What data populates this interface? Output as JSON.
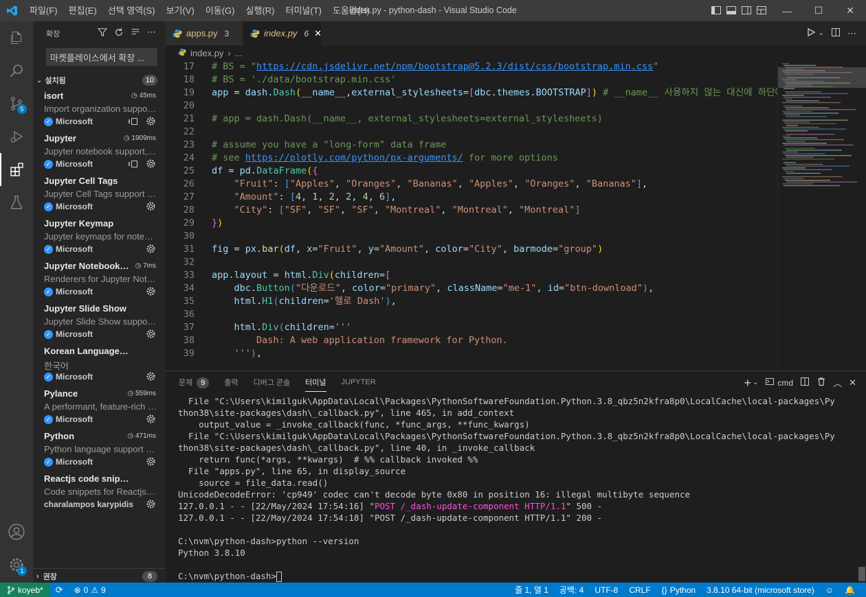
{
  "window": {
    "title": "index.py - python-dash - Visual Studio Code",
    "menu": [
      "파일(F)",
      "편집(E)",
      "선택 영역(S)",
      "보기(V)",
      "이동(G)",
      "실행(R)",
      "터미널(T)",
      "도움말(H)"
    ],
    "controls": {
      "minimize": "—",
      "maximize": "☐",
      "close": "✕"
    }
  },
  "activity_bar": {
    "scm_badge": "5",
    "settings_badge": "1"
  },
  "sidebar": {
    "title": "확장",
    "search_placeholder": "마켓플레이스에서 확장 ...",
    "installed_label": "설치됨",
    "installed_count": "10",
    "recommended_label": "권장",
    "recommended_count": "8",
    "extensions": [
      {
        "name": "isort",
        "time": "45ms",
        "desc": "Import organization support for Python",
        "publisher": "Microsoft",
        "verified": true,
        "sync": true
      },
      {
        "name": "Jupyter",
        "time": "1909ms",
        "desc": "Jupyter notebook support, interactive",
        "publisher": "Microsoft",
        "verified": true,
        "sync": true
      },
      {
        "name": "Jupyter Cell Tags",
        "time": "",
        "desc": "Jupyter Cell Tags support for VS Code",
        "publisher": "Microsoft",
        "verified": true,
        "sync": false
      },
      {
        "name": "Jupyter Keymap",
        "time": "",
        "desc": "Jupyter keymaps for notebooks",
        "publisher": "Microsoft",
        "verified": true,
        "sync": false
      },
      {
        "name": "Jupyter Notebook Renderers",
        "time": "7ms",
        "desc": "Renderers for Jupyter Notebooks",
        "publisher": "Microsoft",
        "verified": true,
        "sync": false
      },
      {
        "name": "Jupyter Slide Show",
        "time": "",
        "desc": "Jupyter Slide Show support for VS Code",
        "publisher": "Microsoft",
        "verified": true,
        "sync": false
      },
      {
        "name": "Korean Language Pack for VS Code",
        "time": "",
        "desc": "한국어",
        "publisher": "Microsoft",
        "verified": true,
        "sync": false
      },
      {
        "name": "Pylance",
        "time": "559ms",
        "desc": "A performant, feature-rich language server",
        "publisher": "Microsoft",
        "verified": true,
        "sync": false
      },
      {
        "name": "Python",
        "time": "471ms",
        "desc": "Python language support with extension access",
        "publisher": "Microsoft",
        "verified": true,
        "sync": false
      },
      {
        "name": "Reactjs code snippets",
        "time": "",
        "desc": "Code snippets for Reactjs development",
        "publisher": "charalampos karypidis",
        "verified": false,
        "sync": false
      }
    ]
  },
  "tabs": [
    {
      "name": "apps.py",
      "problems": "3",
      "active": false
    },
    {
      "name": "index.py",
      "problems": "6",
      "active": true
    }
  ],
  "breadcrumb": {
    "file": "index.py",
    "rest": "..."
  },
  "code_lines": [
    {
      "n": "17",
      "html": "<span class=\"c\"># BS = \"</span><span class=\"u\">https://cdn.jsdelivr.net/npm/bootstrap@5.2.3/dist/css/bootstrap.min.css</span><span class=\"c\">\"</span>"
    },
    {
      "n": "18",
      "html": "<span class=\"c\"># BS = './data/bootstrap.min.css'</span>"
    },
    {
      "n": "19",
      "html": "<span class=\"v\">app</span><span class=\"t\"> = </span><span class=\"v\">dash</span><span class=\"t\">.</span><span class=\"cls\">Dash</span><span class=\"y\">(</span><span class=\"v\">__name__</span><span class=\"t\">,</span><span class=\"v\">external_stylesheets</span><span class=\"t\">=</span><span class=\"ko\">[</span><span class=\"v\">dbc</span><span class=\"t\">.</span><span class=\"v\">themes</span><span class=\"t\">.</span><span class=\"v\">BOOTSTRAP</span><span class=\"ko\">]</span><span class=\"y\">)</span><span class=\"c\"> # __name__ 사용하지 않는 대신에 하단에 app</span>"
    },
    {
      "n": "20",
      "html": ""
    },
    {
      "n": "21",
      "html": "<span class=\"c\"># app = dash.Dash(__name__, external_stylesheets=external_stylesheets)</span>"
    },
    {
      "n": "22",
      "html": ""
    },
    {
      "n": "23",
      "html": "<span class=\"c\"># assume you have a \"long-form\" data frame</span>"
    },
    {
      "n": "24",
      "html": "<span class=\"c\"># see </span><span class=\"u\">https://plotly.com/python/px-arguments/</span><span class=\"c\"> for more options</span>"
    },
    {
      "n": "25",
      "html": "<span class=\"v\">df</span><span class=\"t\"> = </span><span class=\"v\">pd</span><span class=\"t\">.</span><span class=\"cls\">DataFrame</span><span class=\"y\">(</span><span class=\"ko\">{</span>"
    },
    {
      "n": "26",
      "html": "<span class=\"t\">    </span><span class=\"s\">\"Fruit\"</span><span class=\"t\">: </span><span class=\"kw\">[</span><span class=\"s\">\"Apples\"</span><span class=\"t\">, </span><span class=\"s\">\"Oranges\"</span><span class=\"t\">, </span><span class=\"s\">\"Bananas\"</span><span class=\"t\">, </span><span class=\"s\">\"Apples\"</span><span class=\"t\">, </span><span class=\"s\">\"Oranges\"</span><span class=\"t\">, </span><span class=\"s\">\"Bananas\"</span><span class=\"kw\">]</span><span class=\"t\">,</span>"
    },
    {
      "n": "27",
      "html": "<span class=\"t\">    </span><span class=\"s\">\"Amount\"</span><span class=\"t\">: </span><span class=\"kw\">[</span><span class=\"n\">4</span><span class=\"t\">, </span><span class=\"n\">1</span><span class=\"t\">, </span><span class=\"n\">2</span><span class=\"t\">, </span><span class=\"n\">2</span><span class=\"t\">, </span><span class=\"n\">4</span><span class=\"t\">, </span><span class=\"n\">6</span><span class=\"kw\">]</span><span class=\"t\">,</span>"
    },
    {
      "n": "28",
      "html": "<span class=\"t\">    </span><span class=\"s\">\"City\"</span><span class=\"t\">: </span><span class=\"kw\">[</span><span class=\"s\">\"SF\"</span><span class=\"t\">, </span><span class=\"s\">\"SF\"</span><span class=\"t\">, </span><span class=\"s\">\"SF\"</span><span class=\"t\">, </span><span class=\"s\">\"Montreal\"</span><span class=\"t\">, </span><span class=\"s\">\"Montreal\"</span><span class=\"t\">, </span><span class=\"s\">\"Montreal\"</span><span class=\"kw\">]</span>"
    },
    {
      "n": "29",
      "html": "<span class=\"ko\">}</span><span class=\"y\">)</span>"
    },
    {
      "n": "30",
      "html": ""
    },
    {
      "n": "31",
      "html": "<span class=\"v\">fig</span><span class=\"t\"> = </span><span class=\"v\">px</span><span class=\"t\">.</span><span class=\"f\">bar</span><span class=\"y\">(</span><span class=\"v\">df</span><span class=\"t\">, </span><span class=\"v\">x</span><span class=\"t\">=</span><span class=\"s\">\"Fruit\"</span><span class=\"t\">, </span><span class=\"v\">y</span><span class=\"t\">=</span><span class=\"s\">\"Amount\"</span><span class=\"t\">, </span><span class=\"v\">color</span><span class=\"t\">=</span><span class=\"s\">\"City\"</span><span class=\"t\">, </span><span class=\"v\">barmode</span><span class=\"t\">=</span><span class=\"s\">\"group\"</span><span class=\"y\">)</span>"
    },
    {
      "n": "32",
      "html": ""
    },
    {
      "n": "33",
      "html": "<span class=\"v\">app</span><span class=\"t\">.</span><span class=\"v\">layout</span><span class=\"t\"> = </span><span class=\"v\">html</span><span class=\"t\">.</span><span class=\"cls\">Div</span><span class=\"y\">(</span><span class=\"v\">children</span><span class=\"t\">=</span><span class=\"ko\">[</span>"
    },
    {
      "n": "34",
      "html": "<span class=\"t\">    </span><span class=\"v\">dbc</span><span class=\"t\">.</span><span class=\"cls\">Button</span><span class=\"kw\">(</span><span class=\"s\">\"다운로드\"</span><span class=\"t\">, </span><span class=\"v\">color</span><span class=\"t\">=</span><span class=\"s\">\"primary\"</span><span class=\"t\">, </span><span class=\"v\">className</span><span class=\"t\">=</span><span class=\"s\">\"me-1\"</span><span class=\"t\">, </span><span class=\"v\">id</span><span class=\"t\">=</span><span class=\"s\">\"btn-download\"</span><span class=\"kw\">)</span><span class=\"t\">,</span>"
    },
    {
      "n": "35",
      "html": "<span class=\"t\">    </span><span class=\"v\">html</span><span class=\"t\">.</span><span class=\"cls\">H1</span><span class=\"kw\">(</span><span class=\"v\">children</span><span class=\"t\">=</span><span class=\"s\">'헬로 Dash'</span><span class=\"kw\">)</span><span class=\"t\">,</span>"
    },
    {
      "n": "36",
      "html": ""
    },
    {
      "n": "37",
      "html": "<span class=\"t\">    </span><span class=\"v\">html</span><span class=\"t\">.</span><span class=\"cls\">Div</span><span class=\"kw\">(</span><span class=\"v\">children</span><span class=\"t\">=</span><span class=\"s\">'''</span>"
    },
    {
      "n": "38",
      "html": "<span class=\"s\">        Dash: A web application framework for Python.</span>"
    },
    {
      "n": "39",
      "html": "<span class=\"s\">    '''</span><span class=\"kw\">)</span><span class=\"t\">,</span>"
    }
  ],
  "panel": {
    "tabs": [
      {
        "label": "문제",
        "count": "9",
        "active": false
      },
      {
        "label": "출력",
        "count": "",
        "active": false
      },
      {
        "label": "디버그 콘솔",
        "count": "",
        "active": false
      },
      {
        "label": "터미널",
        "count": "",
        "active": true
      },
      {
        "label": "JUPYTER",
        "count": "",
        "active": false
      }
    ],
    "shell_label": "cmd"
  },
  "terminal_lines": [
    {
      "html": "  File \"C:\\Users\\kimilguk\\AppData\\Local\\Packages\\PythonSoftwareFoundation.Python.3.8_qbz5n2kfra8p0\\LocalCache\\local-packages\\Py"
    },
    {
      "html": "thon38\\site-packages\\dash\\_callback.py\", line 465, in add_context"
    },
    {
      "html": "    output_value = _invoke_callback(func, *func_args, **func_kwargs)"
    },
    {
      "html": "  File \"C:\\Users\\kimilguk\\AppData\\Local\\Packages\\PythonSoftwareFoundation.Python.3.8_qbz5n2kfra8p0\\LocalCache\\local-packages\\Py"
    },
    {
      "html": "thon38\\site-packages\\dash\\_callback.py\", line 40, in _invoke_callback"
    },
    {
      "html": "    return func(*args, **kwargs)  # %% callback invoked %%"
    },
    {
      "html": "  File \"apps.py\", line 65, in display_source"
    },
    {
      "html": "    source = file_data.read()"
    },
    {
      "html": "UnicodeDecodeError: 'cp949' codec can't decode byte 0x80 in position 16: illegal multibyte sequence"
    },
    {
      "html": "127.0.0.1 - - [22/May/2024 17:54:16] \"<span class=\"mag\">POST /_dash-update-component HTTP/1.1</span>\" 500 -"
    },
    {
      "html": "127.0.0.1 - - [22/May/2024 17:54:18] \"POST /_dash-update-component HTTP/1.1\" 200 -"
    },
    {
      "html": ""
    },
    {
      "html": "C:\\nvm\\python-dash>python --version"
    },
    {
      "html": "Python 3.8.10"
    },
    {
      "html": ""
    },
    {
      "html": "C:\\nvm\\python-dash><span class=\"cursor\"></span>"
    }
  ],
  "statusbar": {
    "remote": "koyeb*",
    "errors": "0",
    "warnings": "9",
    "position": "줄 1, 열 1",
    "spaces": "공백: 4",
    "encoding": "UTF-8",
    "eol": "CRLF",
    "language": "Python",
    "interpreter": "3.8.10 64-bit (microsoft store)"
  },
  "colors": {
    "accent": "#007acc",
    "titlebar": "#3c3c3c",
    "activitybar": "#333333",
    "sidebar": "#252526",
    "editor": "#1e1e1e"
  }
}
